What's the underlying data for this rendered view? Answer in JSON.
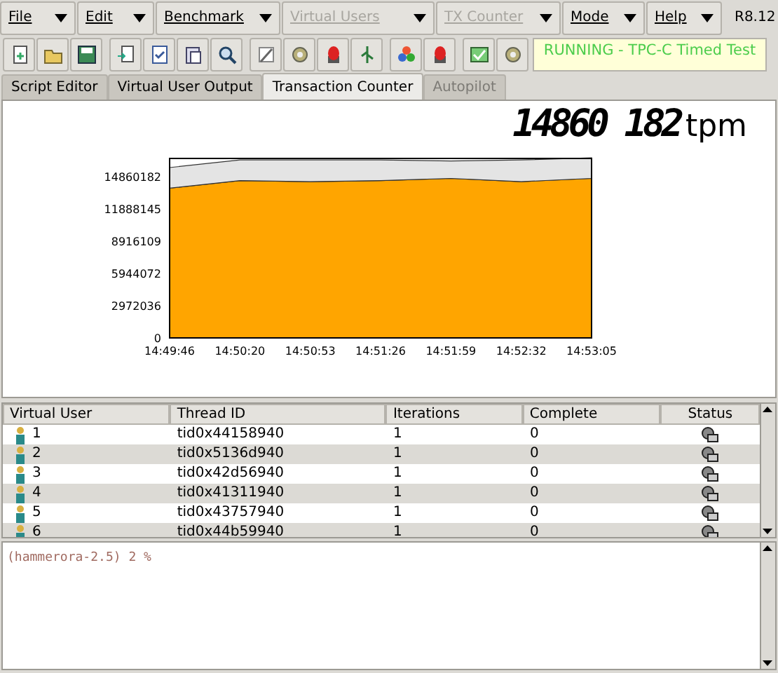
{
  "menus": [
    {
      "label": "File",
      "disabled": false
    },
    {
      "label": "Edit",
      "disabled": false
    },
    {
      "label": "Benchmark",
      "disabled": false
    },
    {
      "label": "Virtual Users",
      "disabled": true
    },
    {
      "label": "TX Counter",
      "disabled": true
    },
    {
      "label": "Mode",
      "disabled": false
    },
    {
      "label": "Help",
      "disabled": false
    }
  ],
  "version": "R8.12",
  "status": "RUNNING - TPC-C Timed Test",
  "tabs": [
    {
      "label": "Script Editor",
      "selected": false,
      "disabled": false
    },
    {
      "label": "Virtual User Output",
      "selected": false,
      "disabled": false
    },
    {
      "label": "Transaction Counter",
      "selected": true,
      "disabled": false
    },
    {
      "label": "Autopilot",
      "selected": false,
      "disabled": true
    }
  ],
  "counter": {
    "value": "14860 182",
    "unit": "tpm"
  },
  "chart_data": {
    "type": "area",
    "stacked": true,
    "categories": [
      "14:49:46",
      "14:50:20",
      "14:50:53",
      "14:51:26",
      "14:51:59",
      "14:52:32",
      "14:53:05"
    ],
    "series": [
      {
        "color": "#ffa500",
        "values": [
          13800000,
          14500000,
          14400000,
          14500000,
          14700000,
          14400000,
          14700000
        ]
      },
      {
        "color": "#e4e4e4",
        "values": [
          1900000,
          1900000,
          2000000,
          1900000,
          1600000,
          2000000,
          1900000
        ]
      }
    ],
    "ylim": [
      0,
      16540000
    ],
    "yticks": [
      0,
      2972036,
      5944072,
      8916109,
      11888145,
      14860182
    ]
  },
  "table": {
    "columns": [
      "Virtual User",
      "Thread ID",
      "Iterations",
      "Complete",
      "Status"
    ],
    "rows": [
      [
        "1",
        "tid0x44158940",
        "1",
        "0"
      ],
      [
        "2",
        "tid0x5136d940",
        "1",
        "0"
      ],
      [
        "3",
        "tid0x42d56940",
        "1",
        "0"
      ],
      [
        "4",
        "tid0x41311940",
        "1",
        "0"
      ],
      [
        "5",
        "tid0x43757940",
        "1",
        "0"
      ],
      [
        "6",
        "tid0x44b59940",
        "1",
        "0"
      ]
    ]
  },
  "console": "(hammerora-2.5) 2 %"
}
